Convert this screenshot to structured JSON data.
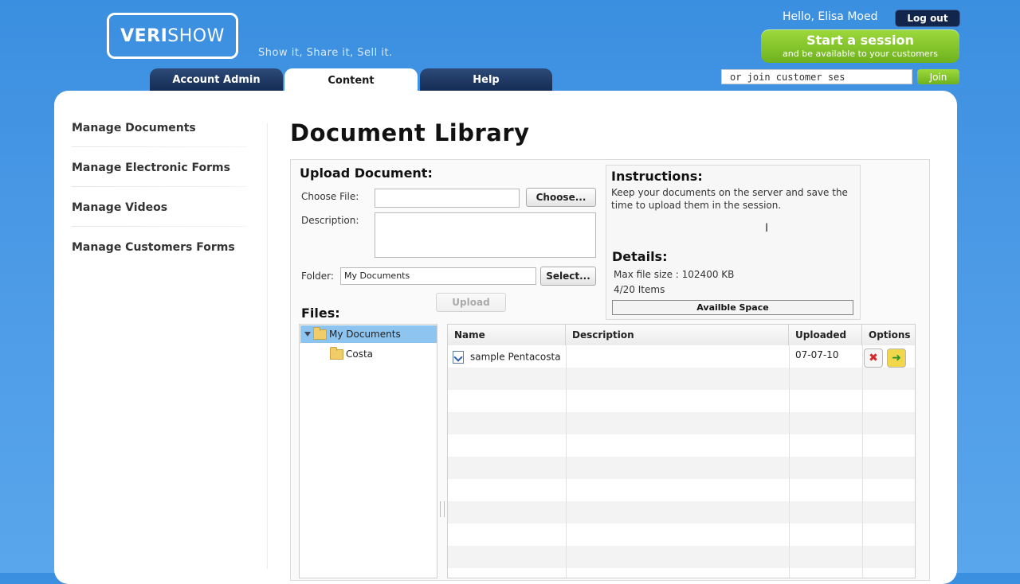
{
  "header": {
    "logo_a": "VERI",
    "logo_b": "SHOW",
    "tagline": "Show it, Share it, Sell it.",
    "greeting": "Hello, Elisa Moed",
    "logout": "Log out",
    "start_title": "Start a session",
    "start_sub": "and be available to your customers",
    "join_placeholder": "or join customer ses",
    "join": "Join"
  },
  "tabs": [
    {
      "label": "Account Admin"
    },
    {
      "label": "Content"
    },
    {
      "label": "Help"
    }
  ],
  "sidebar": {
    "items": [
      {
        "label": "Manage Documents"
      },
      {
        "label": "Manage Electronic Forms"
      },
      {
        "label": "Manage Videos"
      },
      {
        "label": "Manage Customers Forms"
      }
    ]
  },
  "main": {
    "title": "Document Library",
    "upload_heading": "Upload Document:",
    "choose_label": "Choose File:",
    "choose_btn": "Choose...",
    "description_label": "Description:",
    "folder_label": "Folder:",
    "folder_value": "My Documents",
    "select_btn": "Select...",
    "upload_btn": "Upload",
    "files_heading": "Files:"
  },
  "instructions": {
    "heading": "Instructions:",
    "text": "Keep your documents on the server and save the time to upload them in the session.",
    "details_heading": "Details:",
    "max_size": "Max file size : 102400 KB",
    "items": "4/20 Items",
    "space_label": "Availble Space"
  },
  "tree": {
    "root": "My Documents",
    "child": "Costa"
  },
  "grid": {
    "columns": [
      "Name",
      "Description",
      "Uploaded",
      "Options"
    ],
    "rows": [
      {
        "name": "sample Pentacosta",
        "description": "",
        "uploaded": "07-07-10"
      }
    ]
  },
  "colors": {
    "accent_green": "#7cc02a",
    "tab_navy": "#142c55",
    "background_blue": "#4b9ae6"
  }
}
